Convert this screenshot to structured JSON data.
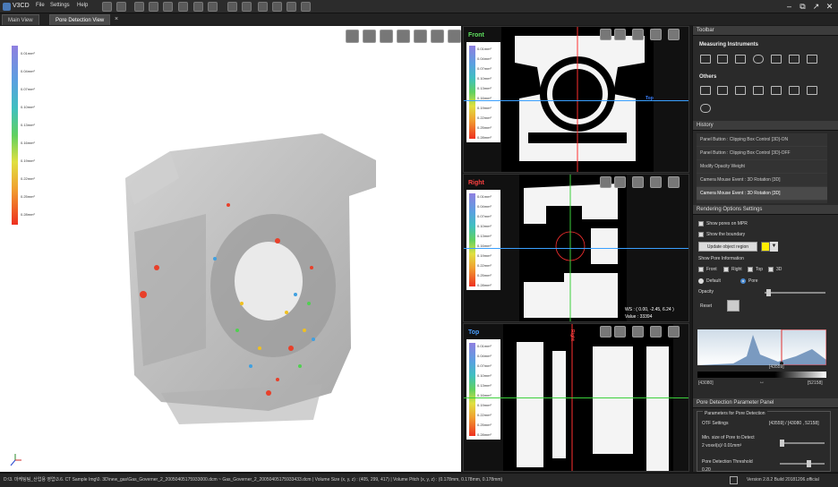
{
  "app": {
    "title": "V3CD"
  },
  "menu": [
    "File",
    "Settings",
    "Help"
  ],
  "tabs": [
    {
      "label": "Main View"
    },
    {
      "label": "Pore Detection View"
    }
  ],
  "legend3d": [
    "0.01mm²",
    "0.04mm²",
    "0.07mm²",
    "0.10mm²",
    "0.13mm²",
    "0.16mm²",
    "0.19mm²",
    "0.22mm²",
    "0.25mm²",
    "0.28mm²"
  ],
  "mpr": {
    "front": {
      "label": "Front",
      "color": "#5fe05f",
      "crosslabel": "Top"
    },
    "right": {
      "label": "Right",
      "color": "#ff4040",
      "ws": "WS : ( 0.00, -2.45, 6.24 )",
      "value": "Value : 33394"
    },
    "top": {
      "label": "Top",
      "color": "#4aa0ff",
      "crosslabel": "Right"
    },
    "legend": [
      "0.01mm²",
      "0.04mm²",
      "0.07mm²",
      "0.10mm²",
      "0.13mm²",
      "0.16mm²",
      "0.19mm²",
      "0.22mm²",
      "0.25mm²",
      "0.28mm²"
    ]
  },
  "toolbar": {
    "header": "Toolbar",
    "measuring": "Measuring Instruments",
    "others": "Others"
  },
  "history": {
    "header": "History",
    "items": [
      "Panel Button : Clipping Box Control [3D]-ON",
      "Panel Button : Clipping Box Control [3D]-OFF",
      "Modify Opacity Weight",
      "Camera Mouse Event : 3D Rotation [3D]",
      "Camera Mouse Event : 3D Rotation [3D]"
    ]
  },
  "rendering": {
    "header": "Rendering Options Settings",
    "show_pores": "Show pores on MPR",
    "show_boundary": "Show the boundary",
    "update_btn": "Update object region",
    "show_pore_info": "Show Pore Information",
    "front": "Front",
    "right": "Right",
    "top": "Top",
    "three_d": "3D",
    "default": "Default",
    "pore": "Pore",
    "opacity": "Opacity",
    "reset": "Reset",
    "hist_mid": "[43559]",
    "hist_left": "[43080]",
    "hist_right": "[52158]",
    "accent": "#ffee00"
  },
  "pore_panel": {
    "header": "Pore Detection Parameter Panel",
    "group": "Parameters for Pore Detection",
    "otf_label": "OTF Settings",
    "otf_value": "[43559] / [43080 , 52158]",
    "minsize_label": "Min. size of Pore to Detect",
    "minsize_value": "2 voxel(s)/ 0.01mm³",
    "threshold_label": "Pore Detection Threshold",
    "threshold_value": "0.20"
  },
  "status": {
    "path": "D:\\3. 마케팅팀_산업용 영업\\3.6. CT Sample Img\\0. 3D\\new_gas\\Gas_Governer_2_20050405175933000.dcm ~ Gas_Governer_2_20050405175933433.dcm | Volume Size (x, y, z) : (405, 299, 417) | Volume Pitch (x, y, z) : (0.178mm, 0.178mm, 0.178mm)",
    "version": "Version 2.8.2 Build 20181206.official"
  }
}
